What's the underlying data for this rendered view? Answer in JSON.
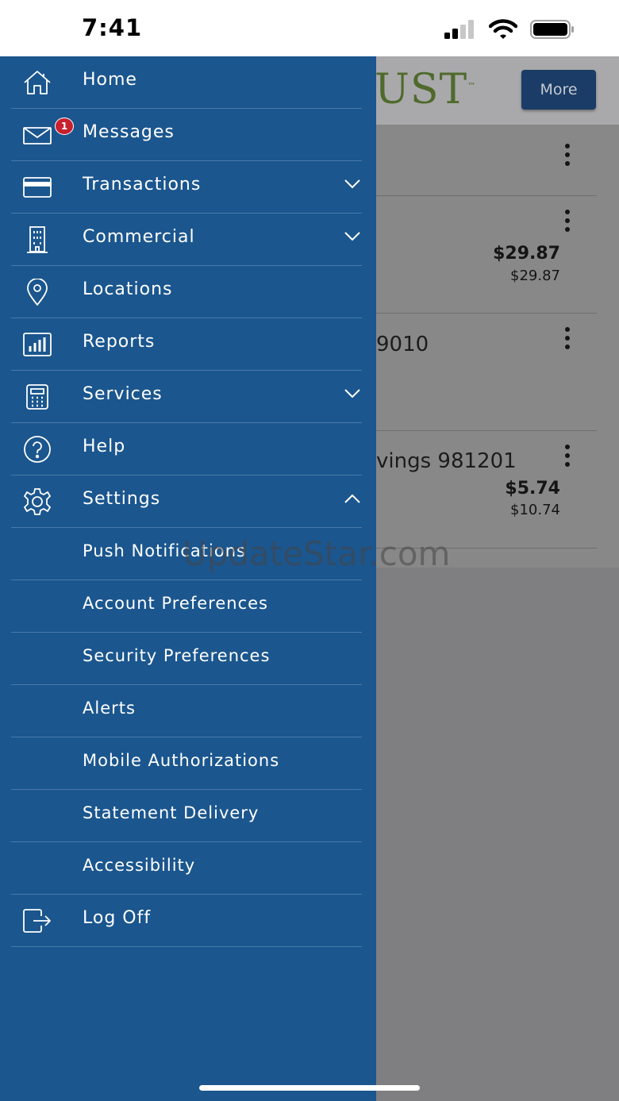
{
  "status_bar": {
    "time": "7:41"
  },
  "background": {
    "logo_text": "UST",
    "more_button": "More",
    "rows": [
      {
        "text": "",
        "amount": "",
        "sub_amount": ""
      },
      {
        "text": "",
        "amount": "$29.87",
        "sub_amount": "$29.87"
      },
      {
        "text": "9010",
        "amount": "",
        "sub_amount": ""
      },
      {
        "text": "vings 981201",
        "amount": "$5.74",
        "sub_amount": "$10.74"
      }
    ]
  },
  "watermark": "UpdateStar.com",
  "menu": {
    "items": [
      {
        "label": "Home",
        "icon": "home-icon"
      },
      {
        "label": "Messages",
        "icon": "envelope-icon",
        "badge": "1"
      },
      {
        "label": "Transactions",
        "icon": "card-icon",
        "expandable": "collapsed"
      },
      {
        "label": "Commercial",
        "icon": "building-icon",
        "expandable": "collapsed"
      },
      {
        "label": "Locations",
        "icon": "map-pin-icon"
      },
      {
        "label": "Reports",
        "icon": "bar-chart-icon"
      },
      {
        "label": "Services",
        "icon": "calculator-icon",
        "expandable": "collapsed"
      },
      {
        "label": "Help",
        "icon": "question-icon"
      },
      {
        "label": "Settings",
        "icon": "gear-icon",
        "expandable": "expanded"
      }
    ],
    "settings_sub": [
      "Push Notifications",
      "Account Preferences",
      "Security Preferences",
      "Alerts",
      "Mobile Authorizations",
      "Statement Delivery",
      "Accessibility"
    ],
    "logoff": {
      "label": "Log Off",
      "icon": "logout-icon"
    }
  },
  "colors": {
    "drawer": "#1b568e",
    "divider": "#4b7aa8",
    "badge": "#c8202d",
    "logo": "#4f6a2c",
    "more_button": "#1a3c66"
  }
}
